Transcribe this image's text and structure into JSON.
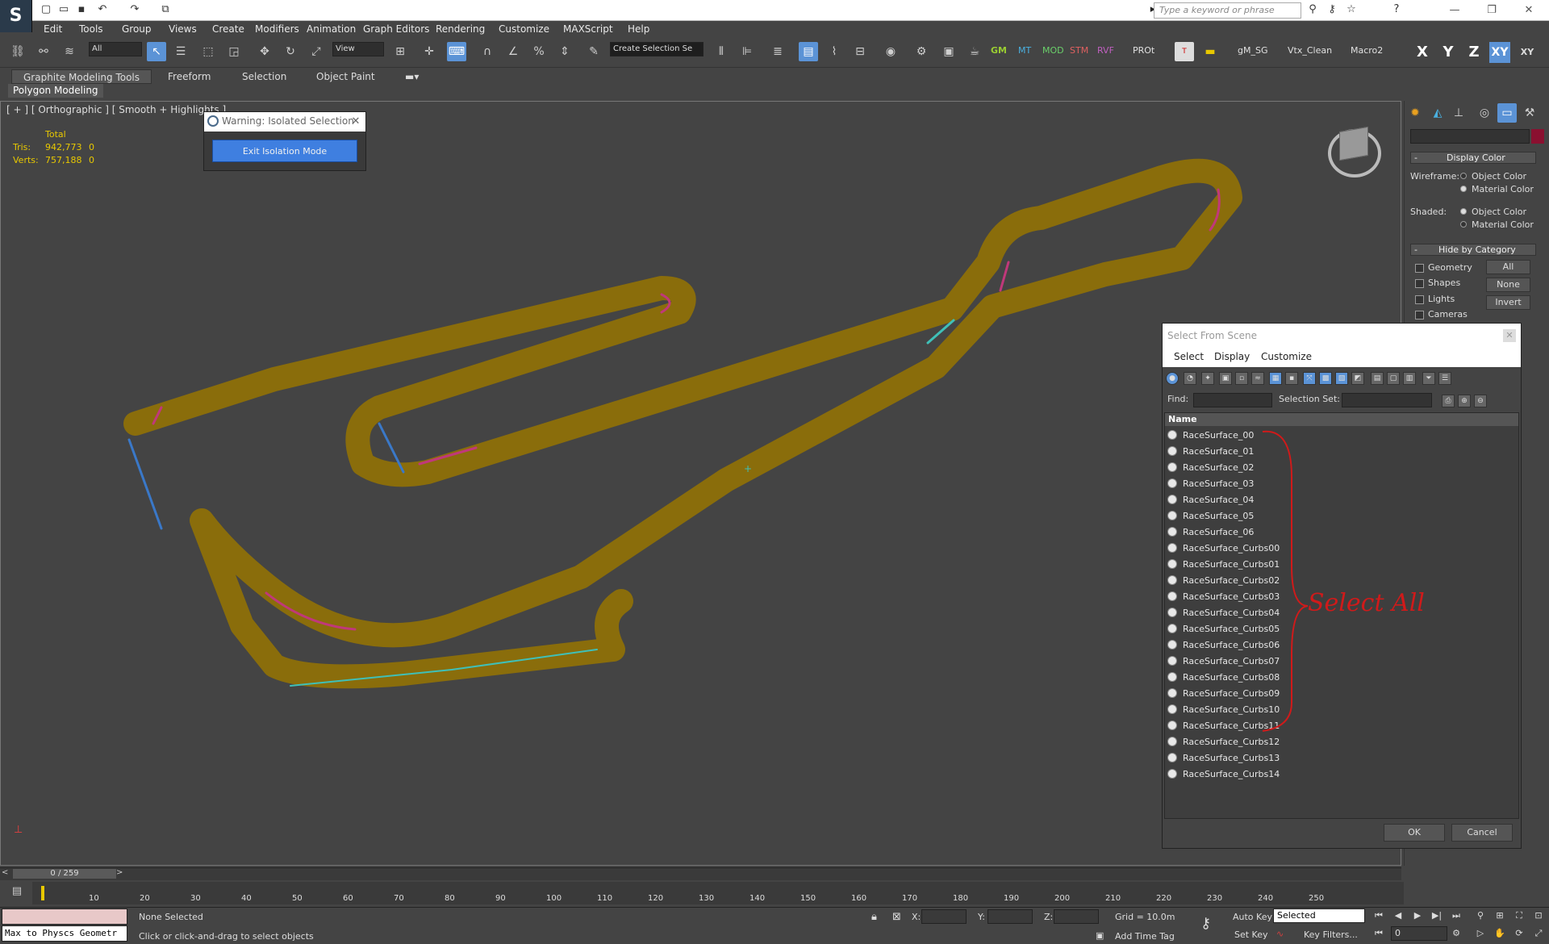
{
  "app": {
    "logo_text": "S"
  },
  "search": {
    "placeholder": "Type a keyword or phrase"
  },
  "menu": [
    "Edit",
    "Tools",
    "Group",
    "Views",
    "Create",
    "Modifiers",
    "Animation",
    "Graph Editors",
    "Rendering",
    "Customize",
    "MAXScript",
    "Help"
  ],
  "toolbar": {
    "filter_value": "All",
    "ref_coord": "View",
    "selection_set": "Create Selection Se",
    "scripts": [
      "GM",
      "MT",
      "MOD",
      "STM",
      "RVF",
      "PROt",
      "gM_SG",
      "Vtx_Clean",
      "Macro2"
    ],
    "axes": [
      "X",
      "Y",
      "Z",
      "XY"
    ]
  },
  "ribbon": {
    "tabs": [
      "Graphite Modeling Tools",
      "Freeform",
      "Selection",
      "Object Paint"
    ],
    "panel_label": "Polygon Modeling"
  },
  "viewport": {
    "label": "[ + ] [ Orthographic ] [ Smooth + Highlights ]",
    "stats": {
      "header": "Total",
      "tris_label": "Tris:",
      "tris": "942,773",
      "tris_sel": "0",
      "verts_label": "Verts:",
      "verts": "757,188",
      "verts_sel": "0"
    },
    "colors": {
      "track": "#8a6d0b",
      "curb_blue": "#3a78c8",
      "curb_pink": "#c0387a",
      "curb_teal": "#3fc0b8"
    }
  },
  "warning": {
    "title": "Warning: Isolated Selection",
    "button": "Exit Isolation Mode"
  },
  "command_panel": {
    "display_color": {
      "title": "Display Color",
      "wireframe_label": "Wireframe:",
      "shaded_label": "Shaded:",
      "opt_object": "Object Color",
      "opt_material": "Material Color"
    },
    "hide_by_category": {
      "title": "Hide by Category",
      "items": [
        "Geometry",
        "Shapes",
        "Lights",
        "Cameras"
      ],
      "buttons": [
        "All",
        "None",
        "Invert"
      ]
    }
  },
  "select_from_scene": {
    "title": "Select From Scene",
    "menus": [
      "Select",
      "Display",
      "Customize"
    ],
    "find_label": "Find:",
    "selection_set_label": "Selection Set:",
    "column_name": "Name",
    "objects": [
      "RaceSurface_00",
      "RaceSurface_01",
      "RaceSurface_02",
      "RaceSurface_03",
      "RaceSurface_04",
      "RaceSurface_05",
      "RaceSurface_06",
      "RaceSurface_Curbs00",
      "RaceSurface_Curbs01",
      "RaceSurface_Curbs02",
      "RaceSurface_Curbs03",
      "RaceSurface_Curbs04",
      "RaceSurface_Curbs05",
      "RaceSurface_Curbs06",
      "RaceSurface_Curbs07",
      "RaceSurface_Curbs08",
      "RaceSurface_Curbs09",
      "RaceSurface_Curbs10",
      "RaceSurface_Curbs11",
      "RaceSurface_Curbs12",
      "RaceSurface_Curbs13",
      "RaceSurface_Curbs14"
    ],
    "ok": "OK",
    "cancel": "Cancel",
    "annotation": "Select All"
  },
  "timeline": {
    "frame": "0 / 259",
    "ticks": [
      "10",
      "20",
      "30",
      "40",
      "50",
      "60",
      "70",
      "80",
      "90",
      "100",
      "110",
      "120",
      "130",
      "140",
      "150",
      "160",
      "170",
      "180",
      "190",
      "200",
      "210",
      "220",
      "230",
      "240",
      "250"
    ]
  },
  "status": {
    "script_listener": "Max to Physcs Geometr",
    "selection": "None Selected",
    "prompt": "Click or click-and-drag to select objects",
    "x_label": "X:",
    "y_label": "Y:",
    "z_label": "Z:",
    "grid": "Grid = 10.0m",
    "add_time_tag": "Add Time Tag",
    "auto_key": "Auto Key",
    "set_key": "Set Key",
    "key_mode": "Selected",
    "key_filters": "Key Filters...",
    "frame_field": "0"
  }
}
